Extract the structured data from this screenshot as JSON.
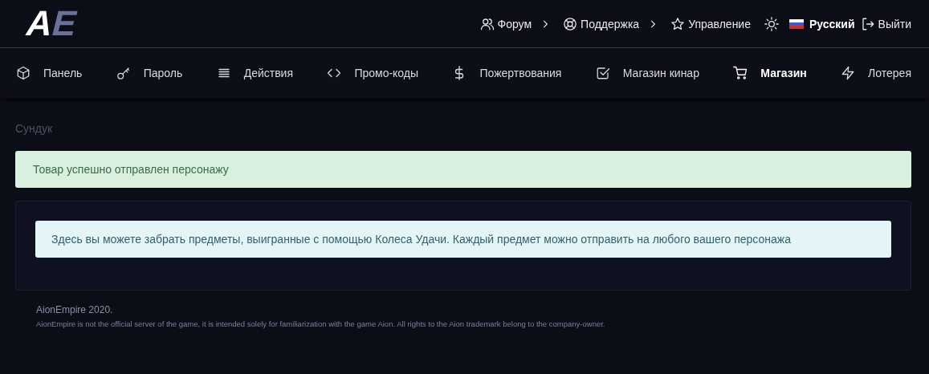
{
  "logo": {
    "left": "A",
    "right": "E"
  },
  "top_links": [
    {
      "label": "Форум",
      "submenu": true
    },
    {
      "label": "Поддержка",
      "submenu": true
    },
    {
      "label": "Управление",
      "submenu": false
    }
  ],
  "language": {
    "label": "Русский"
  },
  "logout": {
    "label": "Выйти"
  },
  "nav": [
    {
      "label": "Панель",
      "selected": false
    },
    {
      "label": "Пароль",
      "selected": false
    },
    {
      "label": "Действия",
      "selected": false
    },
    {
      "label": "Промо-коды",
      "selected": false
    },
    {
      "label": "Пожертвования",
      "selected": false
    },
    {
      "label": "Магазин кинар",
      "selected": false
    },
    {
      "label": "Магазин",
      "selected": true
    },
    {
      "label": "Лотерея",
      "selected": false
    }
  ],
  "breadcrumb": "Сундук",
  "alerts": [
    {
      "kind": "success",
      "text": "Товар успешно отправлен персонажу"
    }
  ],
  "card": {
    "info": "Здесь вы можете забрать предметы, выигранные с помощью Колеса Удачи. Каждый предмет можно отправить на любого вашего персонажа"
  },
  "footer": {
    "title": "AionEmpire 2020.",
    "note": "AionEmpire is not the official server of the game, it is intended solely for familiarization with the game Aion. All rights to the Aion trademark belong to the company-owner."
  }
}
